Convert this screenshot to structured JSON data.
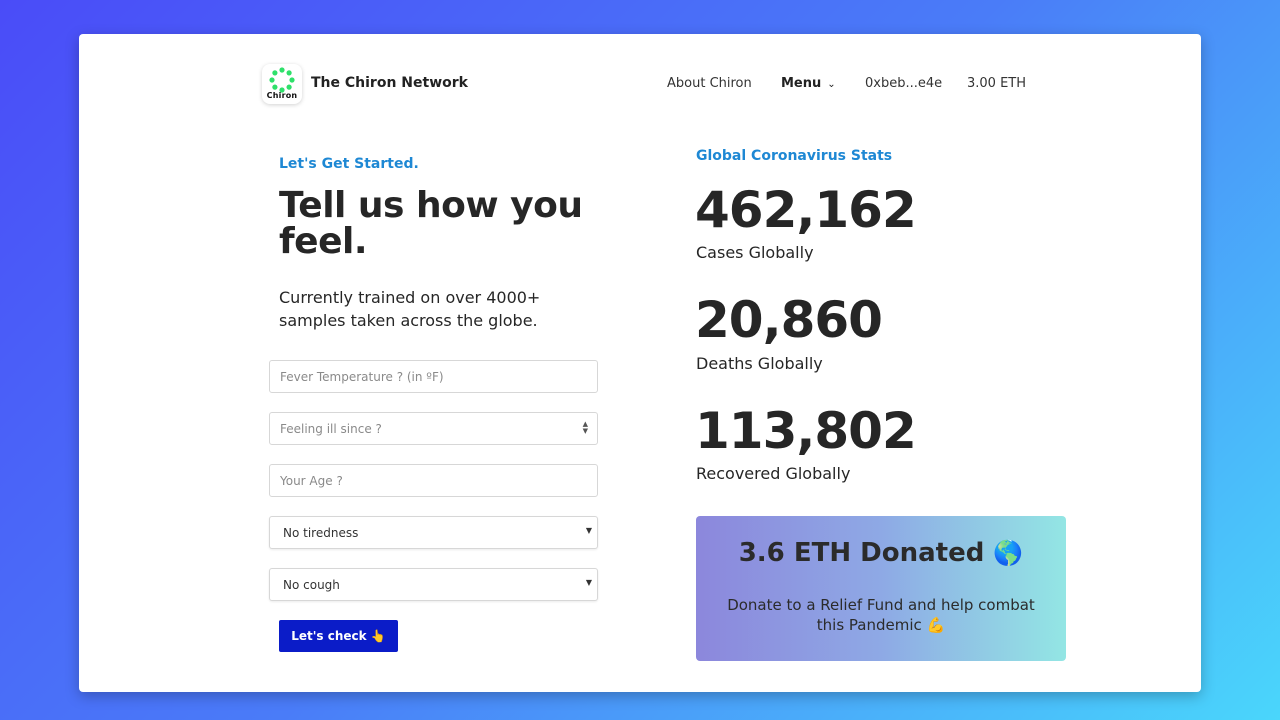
{
  "header": {
    "logo_text": "Chiron",
    "brand": "The Chiron Network",
    "nav": {
      "about": "About Chiron",
      "menu": "Menu",
      "address": "0xbeb...e4e",
      "balance": "3.00 ETH"
    }
  },
  "form": {
    "eyebrow": "Let's Get Started.",
    "headline": "Tell us how you feel.",
    "subtext": "Currently trained on over 4000+ samples taken across the globe.",
    "fields": {
      "fever_placeholder": "Fever Temperature ? (in ºF)",
      "ill_since_placeholder": "Feeling ill since ?",
      "age_placeholder": "Your Age ?"
    },
    "selects": {
      "tiredness": "No tiredness",
      "cough": "No cough"
    },
    "button": "Let's check 👆"
  },
  "stats": {
    "title": "Global Coronavirus Stats",
    "cases": {
      "value": "462,162",
      "label": "Cases Globally"
    },
    "deaths": {
      "value": "20,860",
      "label": "Deaths Globally"
    },
    "recovered": {
      "value": "113,802",
      "label": "Recovered Globally"
    }
  },
  "donation": {
    "title": "3.6 ETH Donated",
    "globe": "🌎",
    "text": "Donate to a Relief Fund and help combat this Pandemic 💪"
  },
  "colors": {
    "accent": "#1e88d4",
    "button": "#0b1cc8",
    "logo_green": "#2ee06a"
  }
}
